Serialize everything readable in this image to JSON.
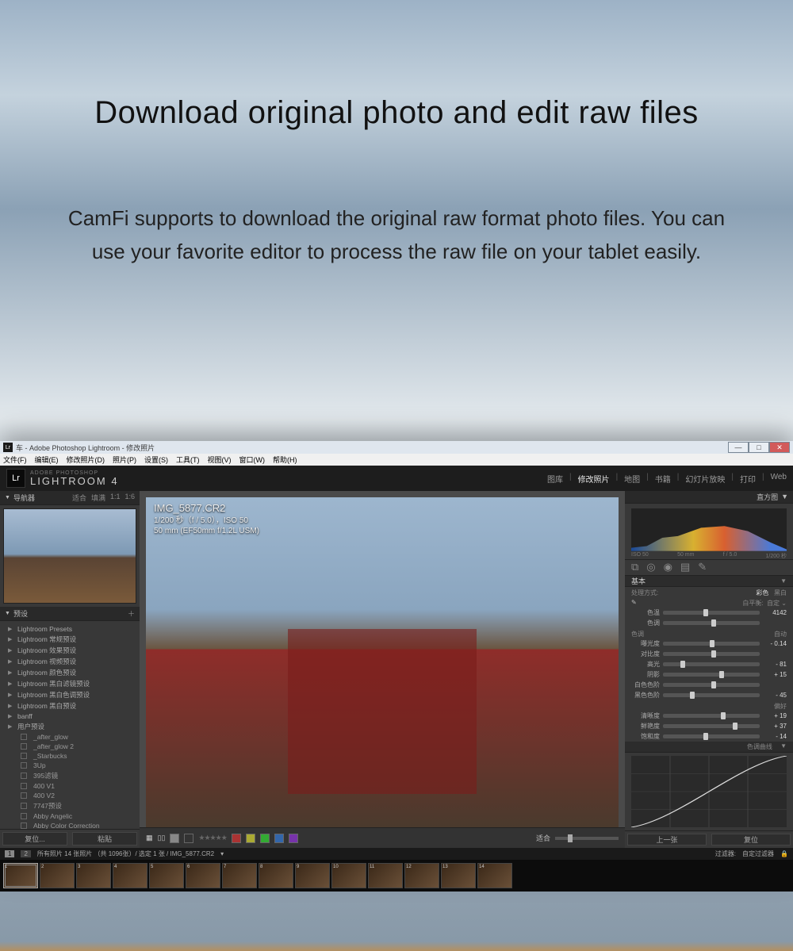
{
  "hero": {
    "title": "Download original photo and edit raw files",
    "body": "CamFi supports to download the original raw format photo files. You can use your favorite editor to process the raw file on your tablet easily."
  },
  "titlebar": {
    "icon": "Lr",
    "text": "车 - Adobe Photoshop Lightroom - 修改照片"
  },
  "menubar": [
    "文件(F)",
    "编辑(E)",
    "修改照片(D)",
    "照片(P)",
    "设置(S)",
    "工具(T)",
    "视图(V)",
    "窗口(W)",
    "帮助(H)"
  ],
  "identity": {
    "small": "ADOBE PHOTOSHOP",
    "big": "LIGHTROOM 4",
    "modules": [
      "图库",
      "修改照片",
      "地图",
      "书籍",
      "幻灯片放映",
      "打印",
      "Web"
    ],
    "active": "修改照片"
  },
  "left": {
    "nav_title": "导航器",
    "nav_zoom": [
      "适合",
      "填满",
      "1:1",
      "1:6"
    ],
    "preset_title": "预设",
    "presets": [
      "Lightroom Presets",
      "Lightroom 常规预设",
      "Lightroom 效果预设",
      "Lightroom 视频预设",
      "Lightroom 颜色预设",
      "Lightroom 黑白滤镜预设",
      "Lightroom 黑白色调预设",
      "Lightroom 黑白预设",
      "banff",
      "用户预设"
    ],
    "subs": [
      "_after_glow",
      "_after_glow 2",
      "_Starbucks",
      "3Up",
      "395滤镜",
      "400 V1",
      "400 V2",
      "7747预设",
      "Abby Angelic",
      "Abby Color Correction"
    ],
    "btn_reset": "复位...",
    "btn_paste": "粘贴"
  },
  "overlay": {
    "filename": "IMG_5877.CR2",
    "line2": "1/200 秒（f / 5.0），ISO 50",
    "line3": "50 mm (EF50mm f/1.2L USM)"
  },
  "center_toolbar": {
    "label": "适合"
  },
  "right": {
    "top_title": "直方图",
    "histo_labels": [
      "ISO 50",
      "50 mm",
      "f / 5.0",
      "1/200 秒"
    ],
    "basic_title": "基本",
    "treatment_label": "处理方式:",
    "treatment_opts": [
      "彩色",
      "黑白"
    ],
    "wb_label": "白平衡:",
    "wb_value": "自定",
    "sliders_wb": [
      {
        "lbl": "色温",
        "val": "4142",
        "pos": 42
      },
      {
        "lbl": "色调",
        "val": "",
        "pos": 50
      }
    ],
    "tone_head": "色调",
    "tone_auto": "自动",
    "sliders_tone": [
      {
        "lbl": "曝光度",
        "val": "- 0.14",
        "pos": 48
      },
      {
        "lbl": "对比度",
        "val": "",
        "pos": 50
      },
      {
        "lbl": "高光",
        "val": "- 81",
        "pos": 18
      },
      {
        "lbl": "阴影",
        "val": "+ 15",
        "pos": 58
      },
      {
        "lbl": "白色色阶",
        "val": "",
        "pos": 50
      },
      {
        "lbl": "黑色色阶",
        "val": "- 45",
        "pos": 28
      }
    ],
    "presence_head": "偏好",
    "sliders_presence": [
      {
        "lbl": "清晰度",
        "val": "+ 19",
        "pos": 60
      },
      {
        "lbl": "鲜艳度",
        "val": "+ 37",
        "pos": 72
      },
      {
        "lbl": "饱和度",
        "val": "- 14",
        "pos": 42
      }
    ],
    "curve_title": "色调曲线",
    "prev": "上一张",
    "next": "复位"
  },
  "status": {
    "left_nums": [
      "1",
      "2"
    ],
    "path": "所有照片  14 张照片 （共 1096张）/ 选定 1 张 / IMG_5877.CR2",
    "filter_label": "过滤器:",
    "filter_value": "自定过滤器"
  },
  "filmstrip_count": 14
}
